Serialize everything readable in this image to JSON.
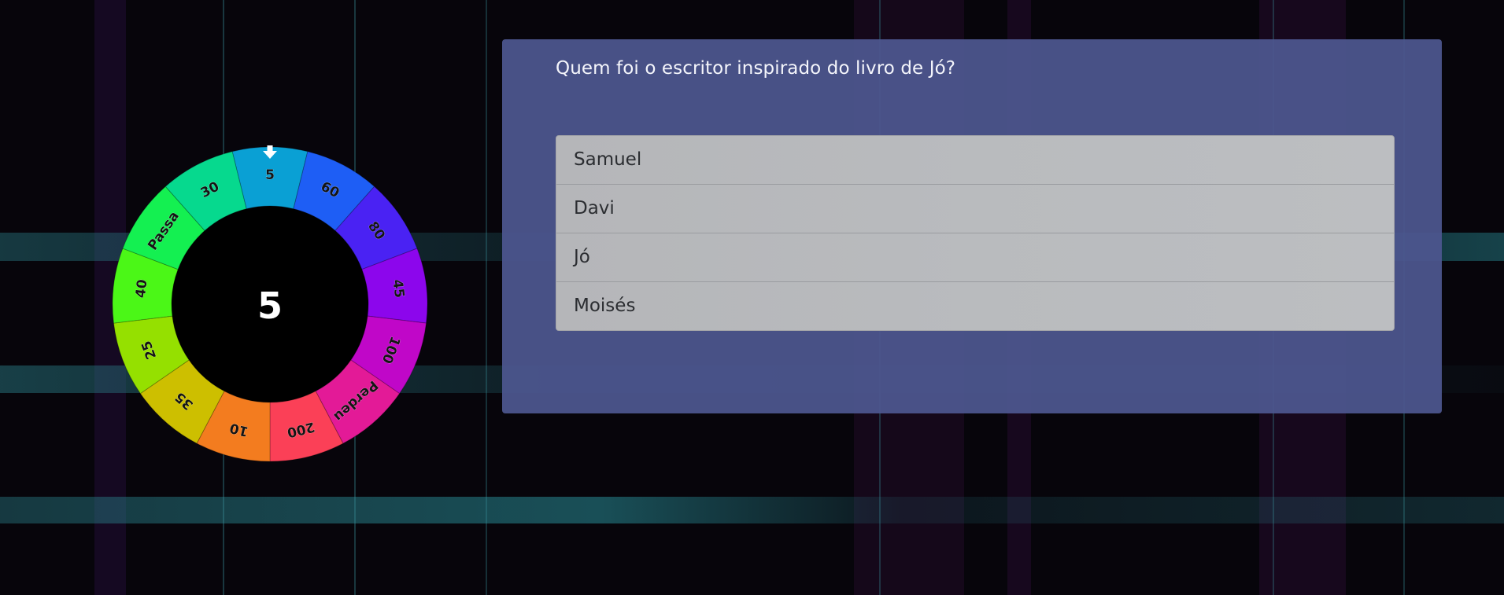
{
  "wheel": {
    "pointer_icon": "arrow-down-icon",
    "center_value": "5",
    "segments": [
      {
        "label": "5",
        "color": "#0aa0d4"
      },
      {
        "label": "60",
        "color": "#1e5ef5"
      },
      {
        "label": "80",
        "color": "#4a22f3"
      },
      {
        "label": "45",
        "color": "#8c06ec"
      },
      {
        "label": "100",
        "color": "#c007c8"
      },
      {
        "label": "Perdeu",
        "color": "#e31a97"
      },
      {
        "label": "200",
        "color": "#fb4057"
      },
      {
        "label": "10",
        "color": "#f37c1f"
      },
      {
        "label": "35",
        "color": "#cdbf00"
      },
      {
        "label": "25",
        "color": "#95e000"
      },
      {
        "label": "40",
        "color": "#4bf717"
      },
      {
        "label": "Passa",
        "color": "#14f051"
      },
      {
        "label": "30",
        "color": "#06d98e"
      }
    ]
  },
  "quiz": {
    "question": "Quem foi o escritor inspirado do livro de Jó?",
    "answers": [
      "Samuel",
      "Davi",
      "Jó",
      "Moisés"
    ]
  }
}
